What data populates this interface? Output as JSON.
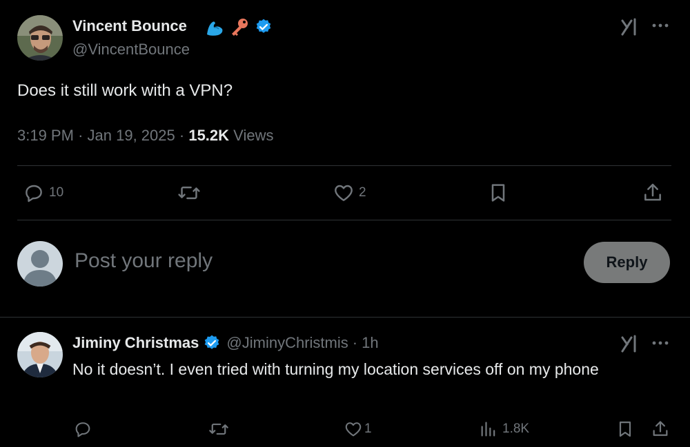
{
  "main_tweet": {
    "author_name": "Vincent Bounce",
    "emoji_icons": [
      "flexed-biceps-icon",
      "key-icon"
    ],
    "verified": true,
    "handle": "@VincentBounce",
    "text": "Does it still work with a VPN?",
    "time": "3:19 PM",
    "date": "Jan 19, 2025",
    "views_count": "15.2K",
    "views_label": "Views",
    "actions": {
      "replies": "10",
      "retweets": "",
      "likes": "2"
    }
  },
  "reply_box": {
    "placeholder": "Post your reply",
    "button_label": "Reply"
  },
  "reply": {
    "author_name": "Jiminy Christmas",
    "verified": true,
    "handle": "@JiminyChristmis",
    "separator": "·",
    "age": "1h",
    "text": "No it doesn’t.  I even tried with turning my location services off on my phone",
    "actions": {
      "replies": "",
      "retweets": "",
      "likes": "1",
      "views": "1.8K"
    }
  },
  "colors": {
    "background": "#000000",
    "text": "#e7e9ea",
    "muted": "#71767b",
    "verified": "#1d9bf0",
    "divider": "#2f3336",
    "reply_button": "#787a7a"
  }
}
